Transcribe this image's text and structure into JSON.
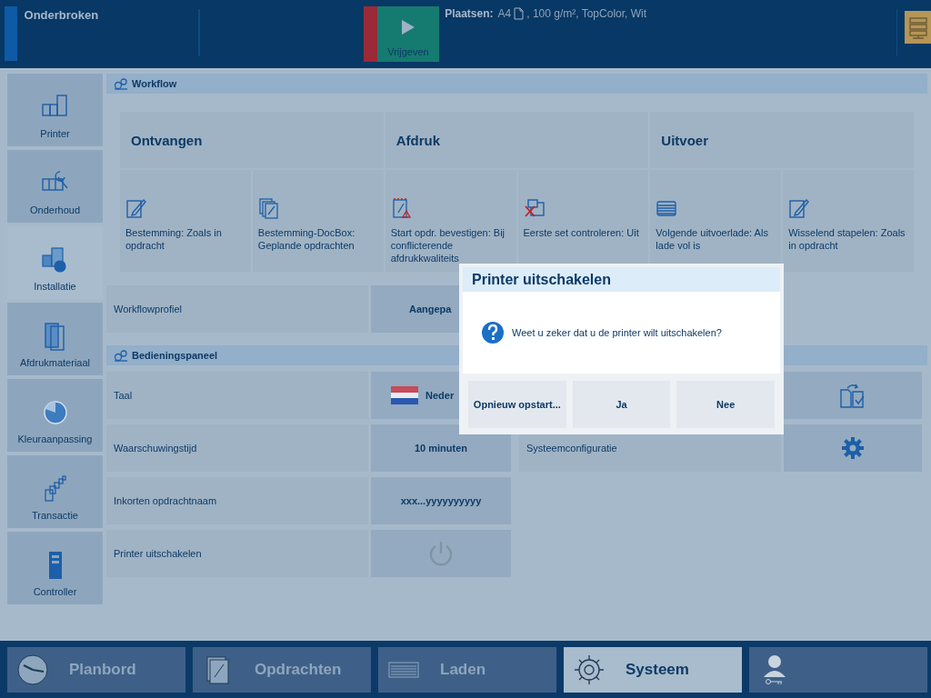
{
  "top_bar": {
    "status": "Onderbroken",
    "release_button": "Vrijgeven",
    "media_label": "Plaatsen:",
    "media_size": "A4",
    "media_details": ", 100 g/m², TopColor, Wit"
  },
  "sidebar": {
    "items": [
      {
        "label": "Printer",
        "selected": false
      },
      {
        "label": "Onderhoud",
        "selected": false
      },
      {
        "label": "Installatie",
        "selected": true
      },
      {
        "label": "Afdrukmateriaal",
        "selected": false
      },
      {
        "label": "Kleuraanpassing",
        "selected": false
      },
      {
        "label": "Transactie",
        "selected": false
      },
      {
        "label": "Controller",
        "selected": false
      }
    ]
  },
  "workflow": {
    "title": "Workflow",
    "groups": [
      {
        "title": "Ontvangen",
        "items": [
          {
            "text": "Bestemming: Zoals in opdracht"
          },
          {
            "text": "Bestemming-DocBox: Geplande opdrachten"
          }
        ]
      },
      {
        "title": "Afdruk",
        "items": [
          {
            "text": "Start opdr. bevestigen: Bij conflicterende afdrukkwaliteits"
          },
          {
            "text": "Eerste set controleren: Uit"
          }
        ]
      },
      {
        "title": "Uitvoer",
        "items": [
          {
            "text": "Volgende uitvoerlade: Als lade vol is"
          },
          {
            "text": "Wisselend stapelen: Zoals in opdracht"
          }
        ]
      }
    ],
    "profile": {
      "label": "Workflowprofiel",
      "value": "Aangepa"
    }
  },
  "control_panel": {
    "title": "Bedieningspaneel",
    "left_rows": [
      {
        "label": "Taal",
        "kind": "flag",
        "value": "Neder"
      },
      {
        "label": "Waarschuwingstijd",
        "kind": "text",
        "value": "10 minuten"
      },
      {
        "label": "Inkorten opdrachtnaam",
        "kind": "text",
        "value": "xxx...yyyyyyyyyy"
      },
      {
        "label": "Printer uitschakelen",
        "kind": "power"
      }
    ],
    "right_rows": [
      {
        "kind": "document-check"
      },
      {
        "label": "Systeemconfiguratie",
        "kind": "gear"
      }
    ]
  },
  "dialog": {
    "title": "Printer uitschakelen",
    "message": "Weet u zeker dat u de printer wilt uitschakelen?",
    "buttons": [
      "Opnieuw opstart...",
      "Ja",
      "Nee"
    ]
  },
  "bottom_tabs": [
    {
      "label": "Planbord",
      "selected": false
    },
    {
      "label": "Opdrachten",
      "selected": false
    },
    {
      "label": "Laden",
      "selected": false
    },
    {
      "label": "Systeem",
      "selected": true
    },
    {
      "kind": "user",
      "selected": false
    }
  ]
}
